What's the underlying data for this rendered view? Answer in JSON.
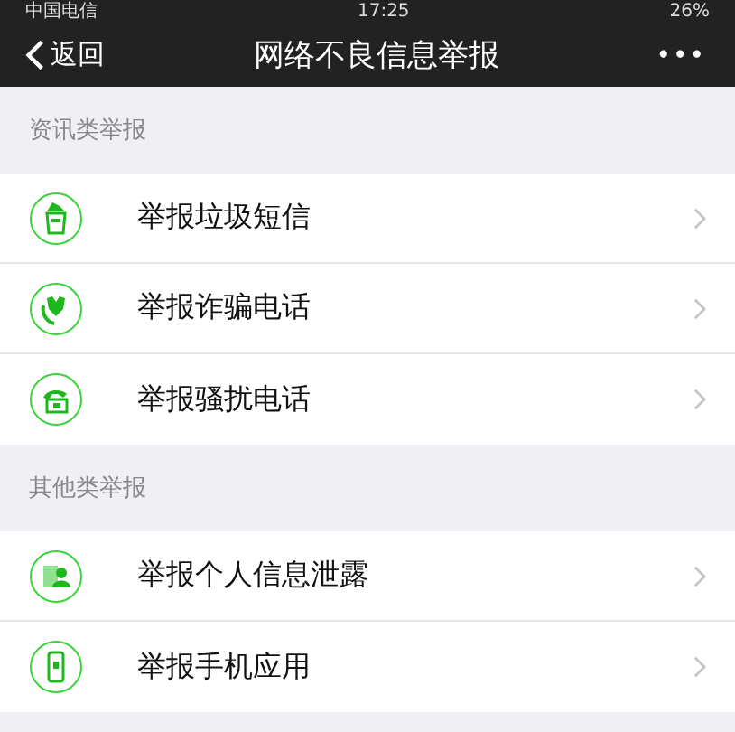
{
  "status_bar": {
    "carrier": "中国电信",
    "time": "17:25",
    "battery": "26%"
  },
  "nav": {
    "back": "返回",
    "title": "网络不良信息举报",
    "more": "•••"
  },
  "sections": [
    {
      "title": "资讯类举报",
      "items": [
        {
          "label": "举报垃圾短信",
          "kind": "trash"
        },
        {
          "label": "举报诈骗电话",
          "kind": "fraud"
        },
        {
          "label": "举报骚扰电话",
          "kind": "phone"
        }
      ]
    },
    {
      "title": "其他类举报",
      "items": [
        {
          "label": "举报个人信息泄露",
          "kind": "person"
        },
        {
          "label": "举报手机应用",
          "kind": "mobile"
        }
      ]
    }
  ]
}
